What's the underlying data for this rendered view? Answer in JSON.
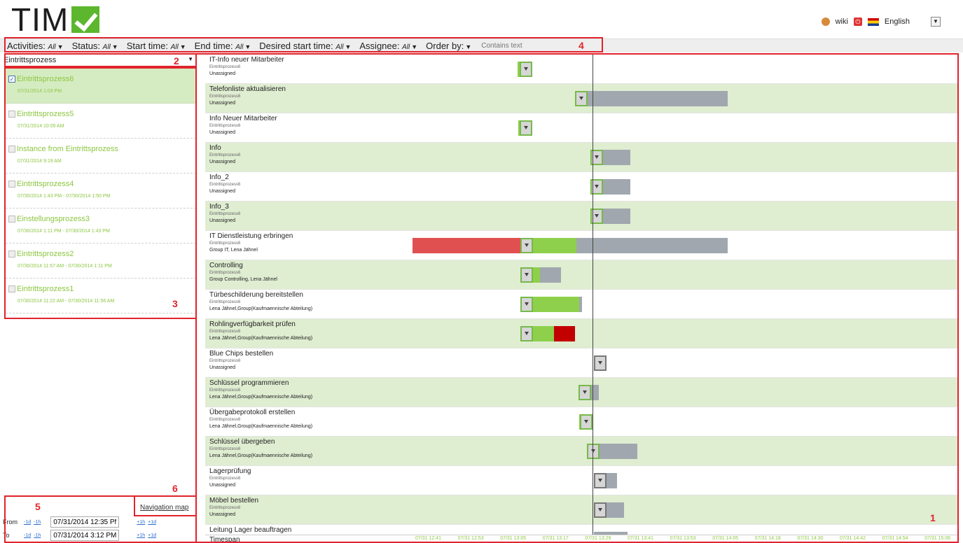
{
  "header": {
    "logo_text": "TIM",
    "user_link": "wiki",
    "language": "English"
  },
  "filters": [
    {
      "label": "Activities:",
      "value": "All"
    },
    {
      "label": "Status:",
      "value": "All"
    },
    {
      "label": "Start time:",
      "value": "All"
    },
    {
      "label": "End time:",
      "value": "All"
    },
    {
      "label": "Desired start time:",
      "value": "All"
    },
    {
      "label": "Assignee:",
      "value": "All"
    },
    {
      "label": "Order by:",
      "value": ""
    }
  ],
  "search_placeholder": "Contains text",
  "process_select": "Eintrittsprozess",
  "instances": [
    {
      "name": "Eintrittsprozess6",
      "date": "07/31/2014 1:03 PM",
      "checked": true
    },
    {
      "name": "Eintrittsprozess5",
      "date": "07/31/2014 10:05 AM",
      "checked": false
    },
    {
      "name": "Instance from Eintrittsprozess",
      "date": "07/31/2014 9:19 AM",
      "checked": false
    },
    {
      "name": "Eintrittsprozess4",
      "date": "07/30/2014 1:43 PM - 07/30/2014 1:50 PM",
      "checked": false
    },
    {
      "name": "Einstellungsprozess3",
      "date": "07/30/2014 1:11 PM - 07/30/2014 1:43 PM",
      "checked": false
    },
    {
      "name": "Eintrittsprozess2",
      "date": "07/30/2014 11:57 AM - 07/30/2014 1:11 PM",
      "checked": false
    },
    {
      "name": "Eintrittsprozess1",
      "date": "07/30/2014 11:22 AM - 07/30/2014 11:56 AM",
      "checked": false
    }
  ],
  "nav_map": "Navigation map",
  "range": {
    "from_label": "From",
    "to_label": "To",
    "minus_day": "-1d",
    "minus_hour": "-1h",
    "plus_hour": "+1h",
    "plus_day": "+1d",
    "from_value": "07/31/2014 12:35 PM",
    "to_value": "07/31/2014 3:12 PM"
  },
  "callouts": [
    "1",
    "2",
    "3",
    "4",
    "5",
    "6"
  ],
  "tasks": [
    {
      "title": "IT-Info neuer Mitarbeiter",
      "process": "Eintrittsprozess6",
      "assignee": "Unassigned",
      "segments": [
        {
          "type": "g",
          "from": 446,
          "to": 454
        }
      ],
      "handle": 449,
      "handle_style": "gray"
    },
    {
      "title": "Telefonliste aktualisieren",
      "process": "Eintrittsprozess6",
      "assignee": "Unassigned",
      "segments": [
        {
          "type": "gray",
          "from": 535,
          "to": 746
        }
      ],
      "handle": 528,
      "handle_style": "gray"
    },
    {
      "title": "Info Neuer Mitarbeiter",
      "process": "Eintrittsprozess6",
      "assignee": "Unassigned",
      "segments": [
        {
          "type": "g",
          "from": 447,
          "to": 454
        }
      ],
      "handle": 449,
      "handle_style": "gray"
    },
    {
      "title": "Info",
      "process": "Eintrittsprozess6",
      "assignee": "Unassigned",
      "segments": [
        {
          "type": "gray",
          "from": 558,
          "to": 607
        }
      ],
      "handle": 550,
      "handle_style": "gray"
    },
    {
      "title": "Info_2",
      "process": "Eintrittsprozess6",
      "assignee": "Unassigned",
      "segments": [
        {
          "type": "gray",
          "from": 558,
          "to": 607
        }
      ],
      "handle": 550,
      "handle_style": "gray"
    },
    {
      "title": "Info_3",
      "process": "Eintrittsprozess6",
      "assignee": "Unassigned",
      "segments": [
        {
          "type": "gray",
          "from": 558,
          "to": 607
        }
      ],
      "handle": 550,
      "handle_style": "gray"
    },
    {
      "title": "IT Dienstleistung erbringen",
      "process": "Eintrittsprozess6",
      "assignee": "Group IT, Lena Jähnel",
      "segments": [
        {
          "type": "r",
          "from": 296,
          "to": 450
        },
        {
          "type": "g",
          "from": 450,
          "to": 530
        },
        {
          "type": "gray",
          "from": 530,
          "to": 746
        }
      ],
      "handle": 450,
      "handle_style": "green"
    },
    {
      "title": "Controlling",
      "process": "Eintrittsprozess6",
      "assignee": "Group Controlling, Lena Jähnel",
      "segments": [
        {
          "type": "g",
          "from": 450,
          "to": 478
        },
        {
          "type": "gray",
          "from": 478,
          "to": 508
        }
      ],
      "handle": 450,
      "handle_style": "green"
    },
    {
      "title": "Türbeschilderung bereitstellen",
      "process": "Eintrittsprozess6",
      "assignee": "Lena Jähnel,Group(Kaufmaennische Abteilung)",
      "segments": [
        {
          "type": "g",
          "from": 450,
          "to": 534
        },
        {
          "type": "gray",
          "from": 534,
          "to": 538
        }
      ],
      "handle": 450,
      "handle_style": "green"
    },
    {
      "title": "Rohlingverfügbarkeit prüfen",
      "process": "Eintrittsprozess6",
      "assignee": "Lena Jähnel,Group(Kaufmaennische Abteilung)",
      "segments": [
        {
          "type": "g",
          "from": 450,
          "to": 498
        },
        {
          "type": "dr",
          "from": 498,
          "to": 528
        }
      ],
      "handle": 450,
      "handle_style": "green"
    },
    {
      "title": "Blue Chips bestellen",
      "process": "Eintrittsprozess6",
      "assignee": "Unassigned",
      "segments": [],
      "handle": 555,
      "handle_style": "plain"
    },
    {
      "title": "Schlüssel programmieren",
      "process": "Eintrittsprozess6",
      "assignee": "Lena Jähnel,Group(Kaufmaennische Abteilung)",
      "segments": [
        {
          "type": "g",
          "from": 533,
          "to": 551
        },
        {
          "type": "gray",
          "from": 551,
          "to": 562
        }
      ],
      "handle": 533,
      "handle_style": "green"
    },
    {
      "title": "Übergabeprotokoll erstellen",
      "process": "Eintrittsprozess6",
      "assignee": "Lena Jähnel,Group(Kaufmaennische Abteilung)",
      "segments": [
        {
          "type": "g",
          "from": 534,
          "to": 550
        }
      ],
      "handle": 535,
      "handle_style": "green"
    },
    {
      "title": "Schlüssel übergeben",
      "process": "Eintrittsprozess6",
      "assignee": "Lena Jähnel,Group(Kaufmaennische Abteilung)",
      "segments": [
        {
          "type": "gray",
          "from": 546,
          "to": 617
        }
      ],
      "handle": 545,
      "handle_style": "gray"
    },
    {
      "title": "Lagerprüfung",
      "process": "Eintrittsprozess6",
      "assignee": "Unassigned",
      "segments": [
        {
          "type": "gray",
          "from": 572,
          "to": 588
        }
      ],
      "handle": 555,
      "handle_style": "plain"
    },
    {
      "title": "Möbel bestellen",
      "process": "Eintrittsprozess6",
      "assignee": "Unassigned",
      "segments": [
        {
          "type": "gray",
          "from": 572,
          "to": 598
        }
      ],
      "handle": 555,
      "handle_style": "plain"
    },
    {
      "title": "Leitung Lager beauftragen",
      "process": "",
      "assignee": "",
      "segments": [
        {
          "type": "gray",
          "from": 555,
          "to": 603
        }
      ],
      "handle": null,
      "handle_style": "none"
    }
  ],
  "axis": {
    "label": "Timespan",
    "ticks": [
      "07/31 12:41",
      "07/31 12:53",
      "07/31 13:05",
      "07/31 13:17",
      "07/31 13:29",
      "07/31 13:41",
      "07/31 13:53",
      "07/31 14:05",
      "07/31 14:18",
      "07/31 14:30",
      "07/31 14:42",
      "07/31 14:54",
      "07/31 15:06"
    ]
  }
}
